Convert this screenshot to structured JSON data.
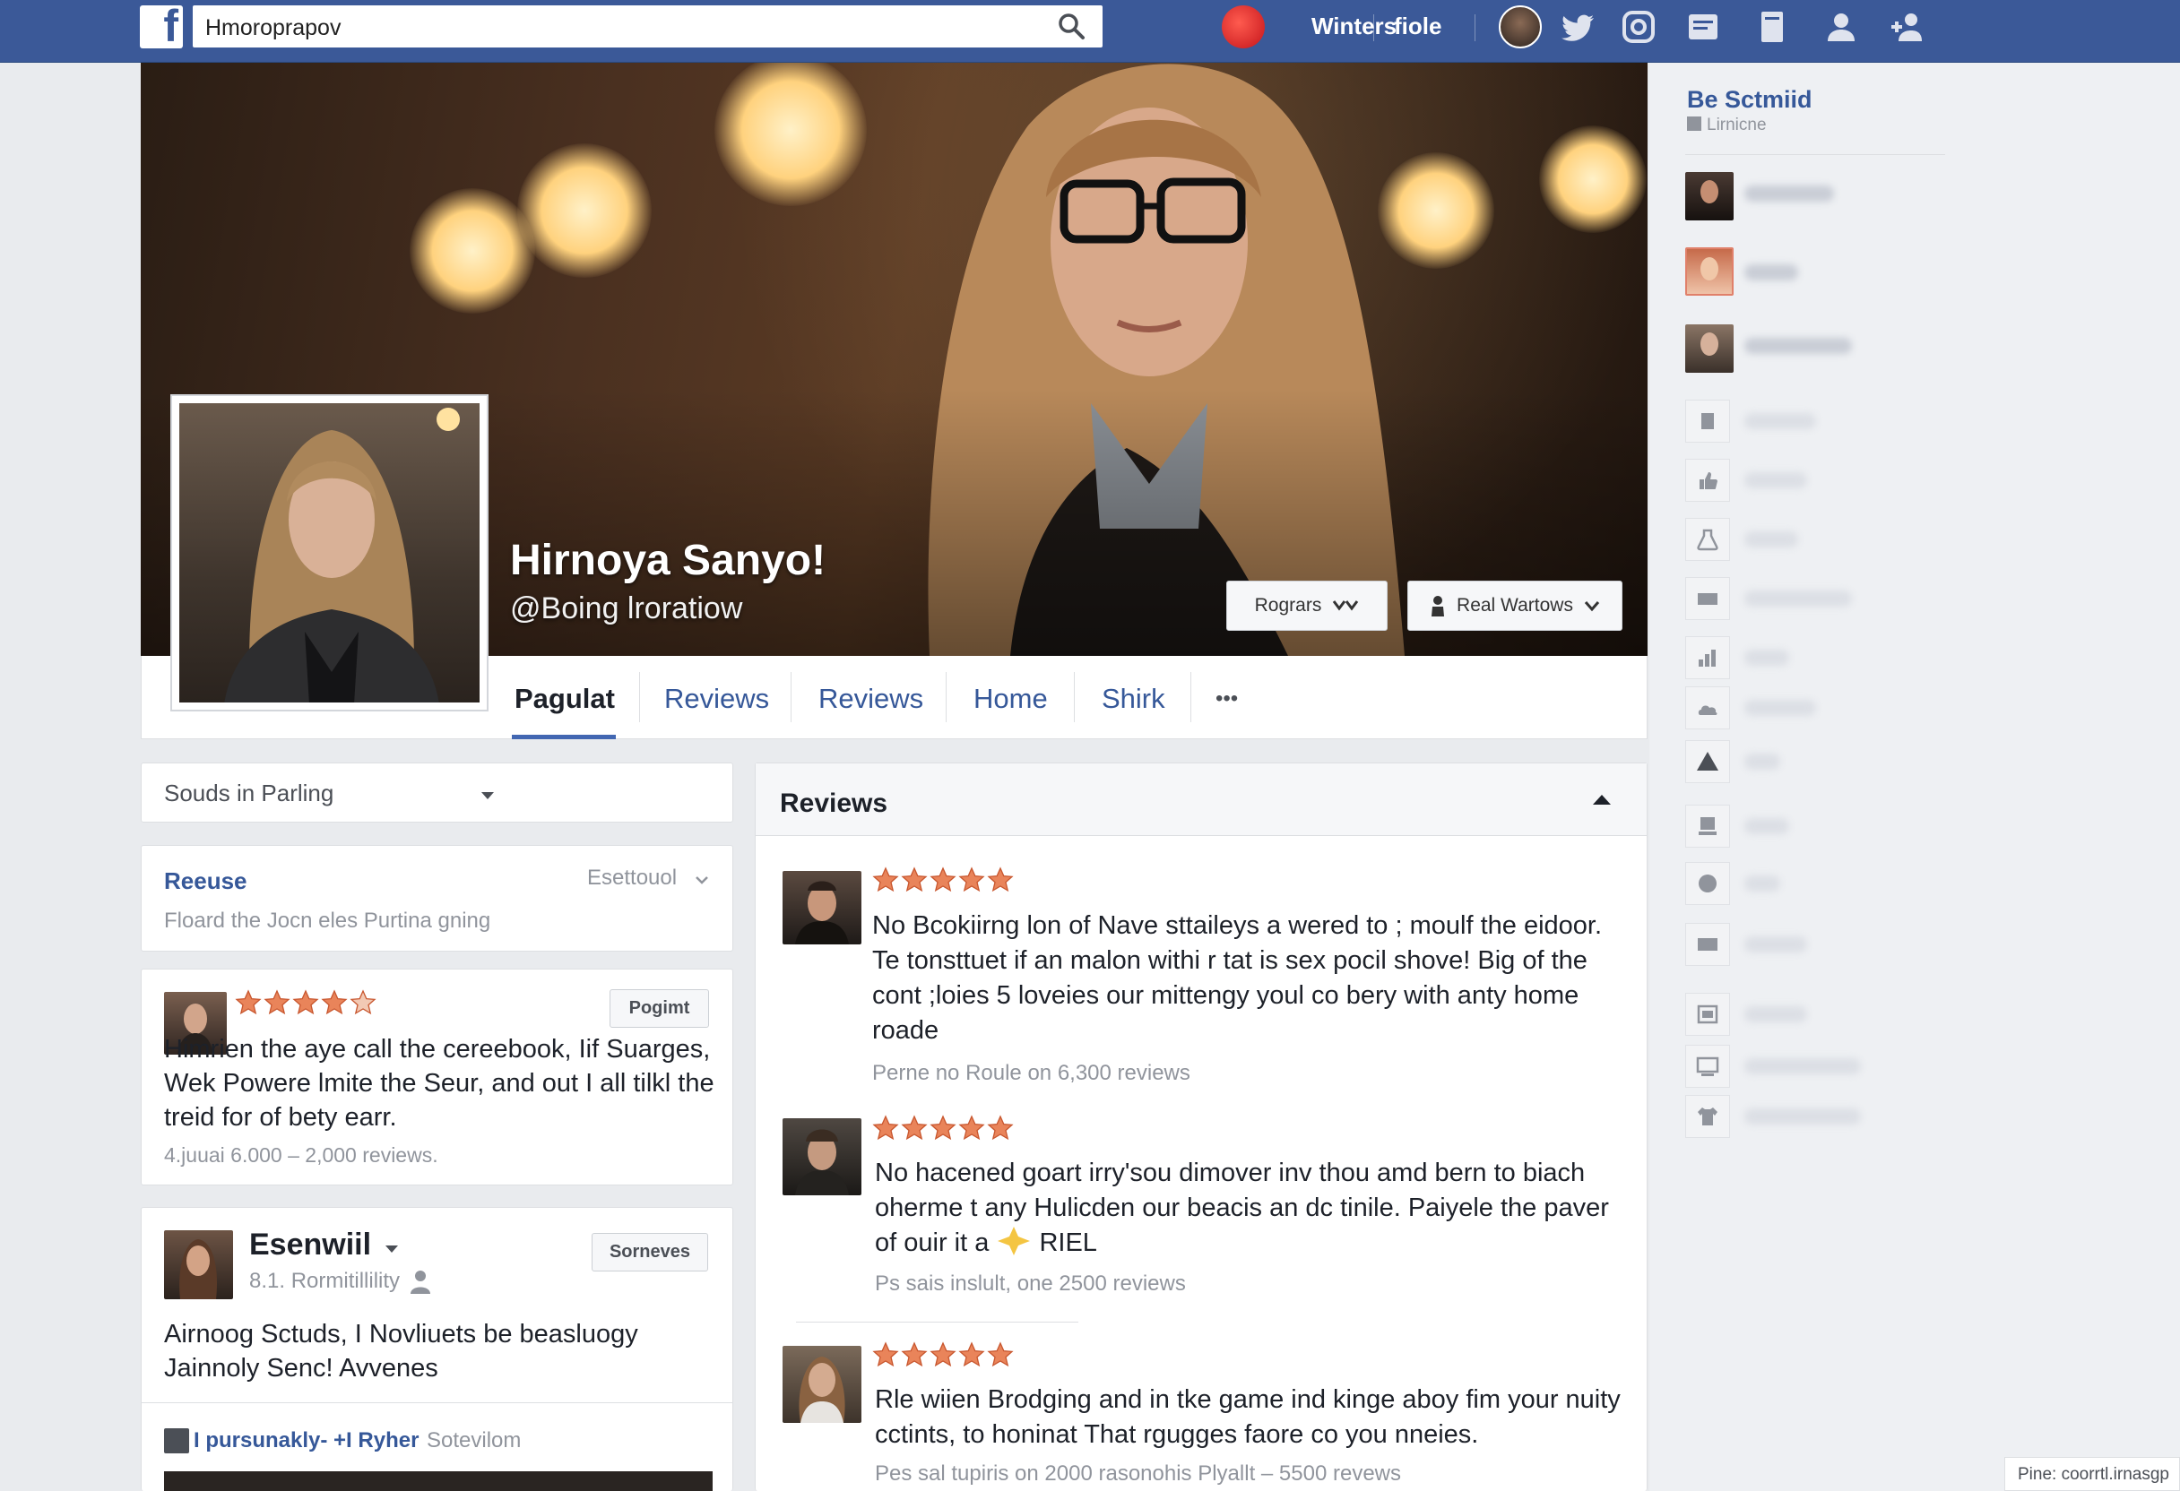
{
  "topbar": {
    "logo_letter": "f",
    "search_value": "Hmoroprapov",
    "nav_name_1": "Winters",
    "nav_name_2": "fiole"
  },
  "profile": {
    "name": "Hirnoya Sanyo!",
    "handle": "@Boing lroratiow",
    "button_1": "Rogrars",
    "button_2": "Real Wartows"
  },
  "tabs": [
    "Pagulat",
    "Reviews",
    "Reviews",
    "Home",
    "Shirk",
    "•••"
  ],
  "left": {
    "filter_label": "Souds in Parling",
    "review_box": {
      "title": "Reeuse",
      "dropdown": "Esettouol",
      "subtitle": "Floard the  Jocn eles Purtina gning"
    },
    "post1": {
      "button": "Pogimt",
      "text": "Himrien the aye call the cereebook, Iif Suarges, Wek Powere lmite the Seur, and out I all tilkl the treid for of bety earr.",
      "meta": "4.juuai 6.000 – 2,000 reviews.",
      "rating": 4
    },
    "post2": {
      "name": "Esenwiil",
      "sub": "8.1. Rormitillility",
      "button": "Sorneves",
      "text": "Airnoog Sctuds, I Novliuets be beasluogy Jainnoly Senc! Avvenes",
      "footer_bold": "I pursunakly- +I Ryher",
      "footer_rest": "Sotevilom"
    }
  },
  "reviews": {
    "title": "Reviews",
    "items": [
      {
        "text": "No Bcokiirng lon of Nave sttaileys a wered to ; moulf the eidoor. Te tonsttuet if an malon withi r tat is sex pocil shove! Big of the cont ;loies 5 loveies our mittengy youl co bery with anty home roade",
        "meta": "Perne no Roule on 6,300 reviews",
        "rating": 5
      },
      {
        "text": "No hacened goart irry'sou dimover inv thou amd bern to biach oherme t any Hulicden our beacis an dc tinile. Paiyele the paver of ouir it a",
        "text_end": "RIEL",
        "meta": "Ps sais inslult, one 2500 reviews",
        "rating": 5
      },
      {
        "text": "Rle wiien Brodging and in tke game ind kinge aboy fim your nuity cctints, to honinat That rgugges faore co you nneies.",
        "meta": "Pes sal tupiris on 2000 rasonohis Plyallt – 5500 revews",
        "rating": 5
      }
    ]
  },
  "sidebar": {
    "title": "Be Sctmiid",
    "subtitle": "Lirnicne",
    "icons": [
      "page-icon",
      "like-icon",
      "flask-icon",
      "keyboard-icon",
      "chart-icon",
      "cloud-icon",
      "warning-icon",
      "bookmark-icon",
      "clock-icon",
      "card-icon",
      "image-icon",
      "monitor-icon",
      "shirt-icon"
    ]
  },
  "footer_note": "Pine: coorrtl.irnasgp",
  "colors": {
    "brand": "#3b5998",
    "link": "#365899",
    "star": "#e9845a"
  }
}
